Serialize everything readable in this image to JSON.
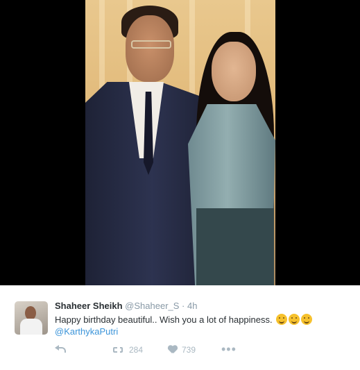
{
  "media": {
    "photo_icon": "photo-of-man-and-woman"
  },
  "tweet": {
    "avatar_icon": "profile-avatar",
    "display_name": "Shaheer Sheikh",
    "handle": "@Shaheer_S",
    "separator": "·",
    "timestamp": "4h",
    "text": "Happy birthday beautiful.. Wish you a lot of happiness.",
    "emojis": [
      "smiling-face-emoji",
      "smiling-face-emoji",
      "smiling-face-emoji"
    ],
    "mention": "@KarthykaPutri",
    "actions": {
      "reply_icon": "reply-icon",
      "retweet_icon": "retweet-icon",
      "retweet_count": "284",
      "like_icon": "heart-icon",
      "like_count": "739",
      "more_label": "•••"
    }
  },
  "colors": {
    "link": "#3b94d9",
    "muted": "#8899a6",
    "text": "#292f33",
    "action": "#aab8c2"
  }
}
